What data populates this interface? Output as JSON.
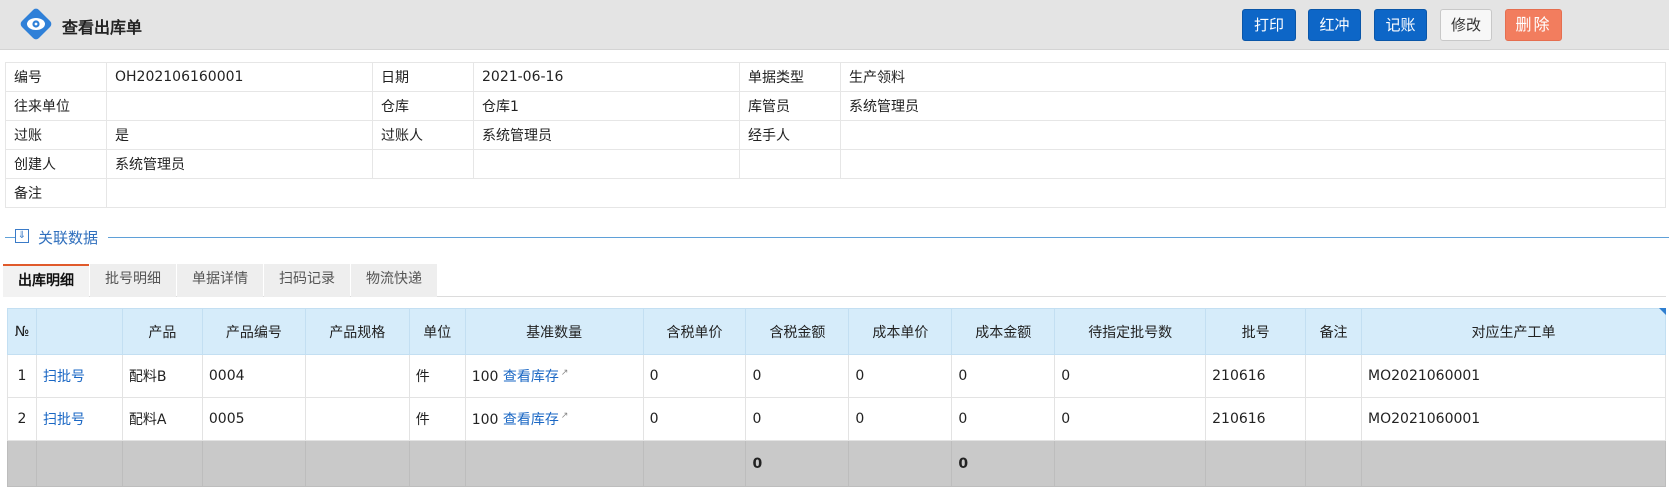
{
  "header": {
    "title": "查看出库单",
    "buttons": {
      "print": "打印",
      "reverse": "红冲",
      "post": "记账",
      "edit": "修改",
      "delete": "删除"
    },
    "colors": {
      "primary": "#0d66c7",
      "danger": "#f27d5e"
    }
  },
  "info": {
    "rows": [
      [
        "编号",
        "OH202106160001",
        "日期",
        "2021-06-16",
        "单据类型",
        "生产领料"
      ],
      [
        "往来单位",
        "",
        "仓库",
        "仓库1",
        "库管员",
        "系统管理员"
      ],
      [
        "过账",
        "是",
        "过账人",
        "系统管理员",
        "经手人",
        ""
      ],
      [
        "创建人",
        "系统管理员",
        "",
        "",
        "",
        ""
      ],
      [
        "备注",
        ""
      ]
    ]
  },
  "section": {
    "label": "关联数据"
  },
  "tabs": [
    "出库明细",
    "批号明细",
    "单据详情",
    "扫码记录",
    "物流快递"
  ],
  "grid": {
    "headers": [
      "№",
      "",
      "产品",
      "产品编号",
      "产品规格",
      "单位",
      "基准数量",
      "含税单价",
      "含税金额",
      "成本单价",
      "成本金额",
      "待指定批号数",
      "批号",
      "备注",
      "对应生产工单"
    ],
    "rows": [
      {
        "no": "1",
        "action": "扫批号",
        "product": "配料B",
        "code": "0004",
        "spec": "",
        "unit": "件",
        "qty": "100",
        "stock_link": "查看库存",
        "tax_price": "0",
        "tax_amount": "0",
        "cost_price": "0",
        "cost_amount": "0",
        "pending": "0",
        "batch": "210616",
        "note": "",
        "work_order": "MO2021060001"
      },
      {
        "no": "2",
        "action": "扫批号",
        "product": "配料A",
        "code": "0005",
        "spec": "",
        "unit": "件",
        "qty": "100",
        "stock_link": "查看库存",
        "tax_price": "0",
        "tax_amount": "0",
        "cost_price": "0",
        "cost_amount": "0",
        "pending": "0",
        "batch": "210616",
        "note": "",
        "work_order": "MO2021060001"
      }
    ],
    "totals": {
      "tax_amount": "0",
      "cost_amount": "0"
    }
  }
}
